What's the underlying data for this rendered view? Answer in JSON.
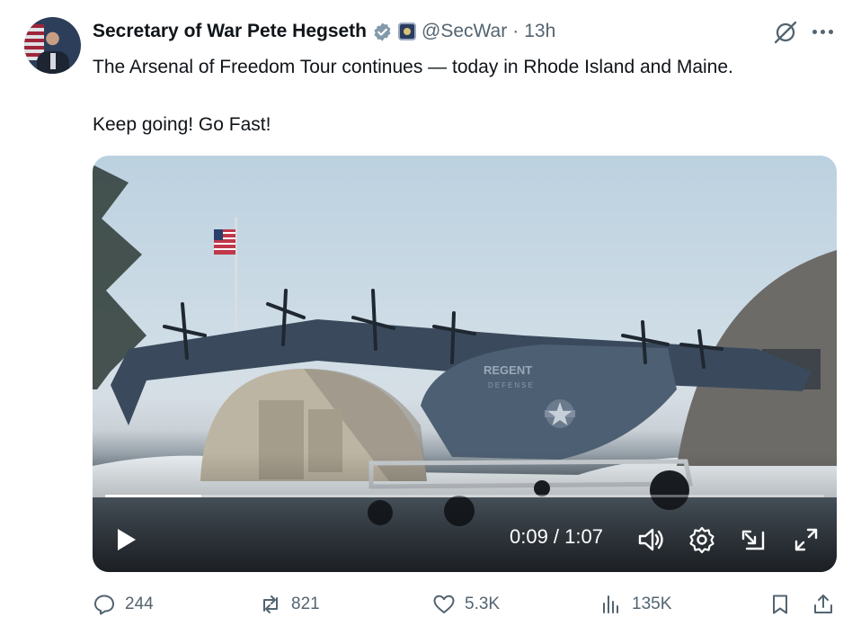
{
  "author": {
    "display_name": "Secretary of War Pete Hegseth",
    "handle": "@SecWar",
    "separator": "·",
    "time": "13h"
  },
  "tweet": {
    "line1": "The Arsenal of Freedom Tour continues — today in Rhode Island and Maine.",
    "line2": "Keep going! Go Fast!"
  },
  "video": {
    "time_label": "0:09 / 1:07",
    "progress": 0.134,
    "aircraft_label": "REGENT",
    "aircraft_sublabel": "DEFENSE"
  },
  "actions": {
    "replies": "244",
    "reposts": "821",
    "likes": "5.3K",
    "views": "135K"
  },
  "colors": {
    "text": "#0f1419",
    "secondary": "#536471",
    "verified": "#829aab"
  }
}
